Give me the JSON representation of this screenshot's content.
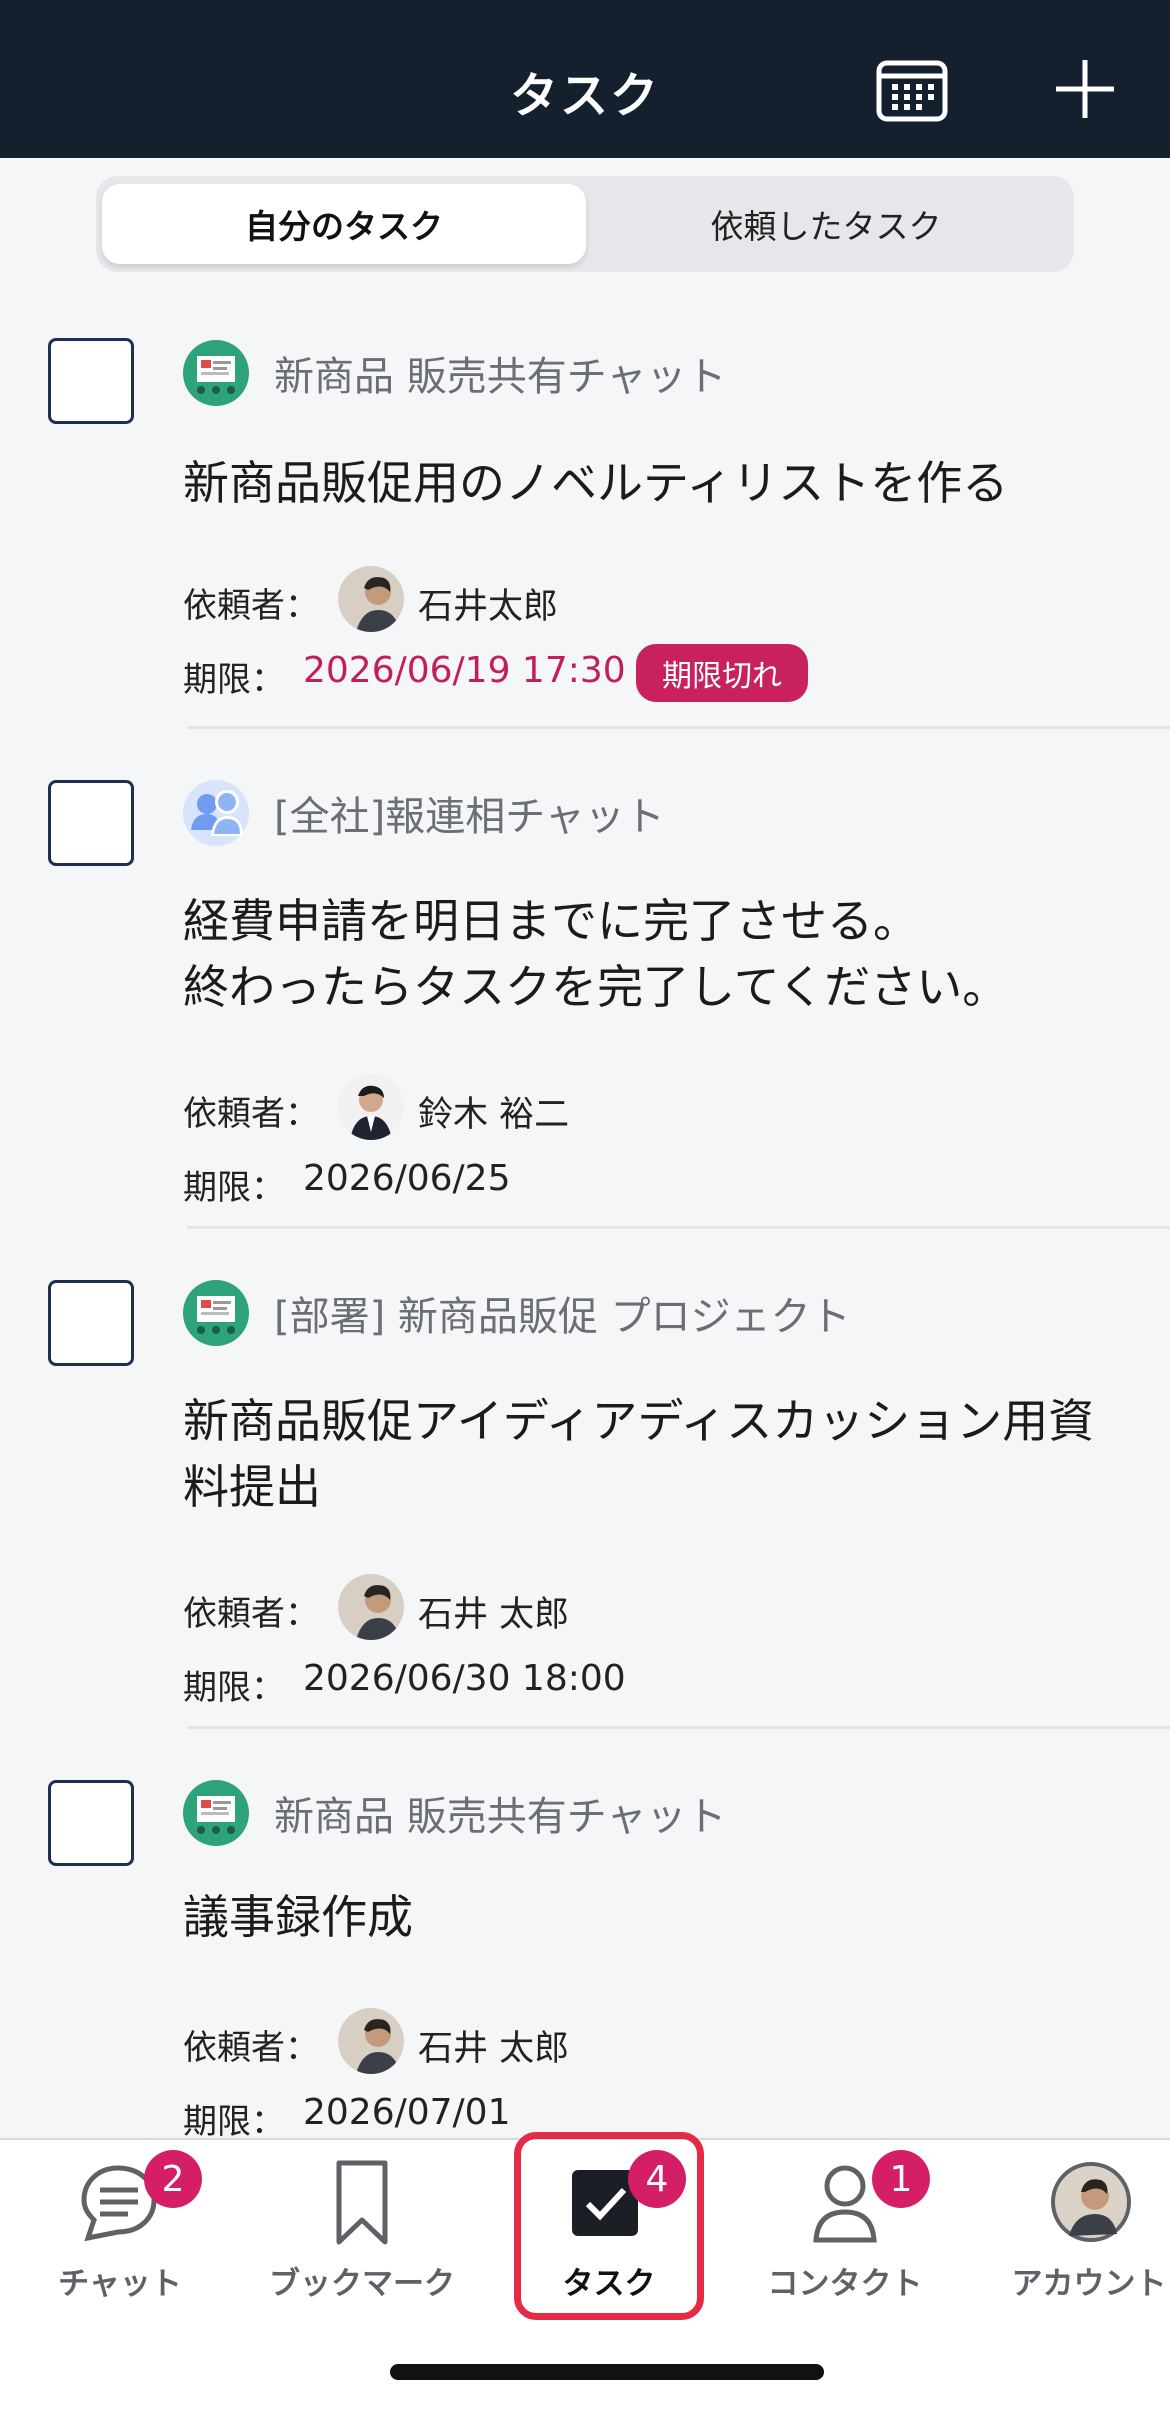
{
  "header": {
    "title": "タスク",
    "calendar_icon": "calendar-icon",
    "add_icon": "plus-icon"
  },
  "segment": {
    "my_tasks": "自分のタスク",
    "requested_tasks": "依頼したタスク"
  },
  "labels": {
    "requester": "依頼者：",
    "due": "期限："
  },
  "tasks": [
    {
      "room": "新商品 販売共有チャット",
      "room_icon": "group-chat-icon",
      "title": "新商品販促用のノベルティリストを作る",
      "requester": "石井太郎",
      "due": "2026/06/19 17:30",
      "overdue": true,
      "overdue_label": "期限切れ"
    },
    {
      "room": "[全社]報連相チャット",
      "room_icon": "people-icon",
      "title": "経費申請を明日までに完了させる。\n終わったらタスクを完了してください。",
      "requester": "鈴木 裕二",
      "due": "2026/06/25",
      "overdue": false
    },
    {
      "room": "[部署] 新商品販促 プロジェクト",
      "room_icon": "group-chat-icon",
      "title": "新商品販促アイディアディスカッション用資料提出",
      "requester": "石井 太郎",
      "due": "2026/06/30 18:00",
      "overdue": false
    },
    {
      "room": "新商品 販売共有チャット",
      "room_icon": "group-chat-icon",
      "title": "議事録作成",
      "requester": "石井 太郎",
      "due": "2026/07/01",
      "overdue": false
    }
  ],
  "nav": {
    "chat": {
      "label": "チャット",
      "badge": "2",
      "icon": "chat-bubble-icon"
    },
    "bookmark": {
      "label": "ブックマーク",
      "icon": "bookmark-icon"
    },
    "task": {
      "label": "タスク",
      "badge": "4",
      "icon": "checkbox-icon"
    },
    "contact": {
      "label": "コンタクト",
      "badge": "1",
      "icon": "person-icon"
    },
    "account": {
      "label": "アカウント",
      "icon": "avatar-icon"
    }
  },
  "colors": {
    "header_bg": "#15202f",
    "accent_red": "#c8215d",
    "highlight_border": "#e52a48"
  }
}
